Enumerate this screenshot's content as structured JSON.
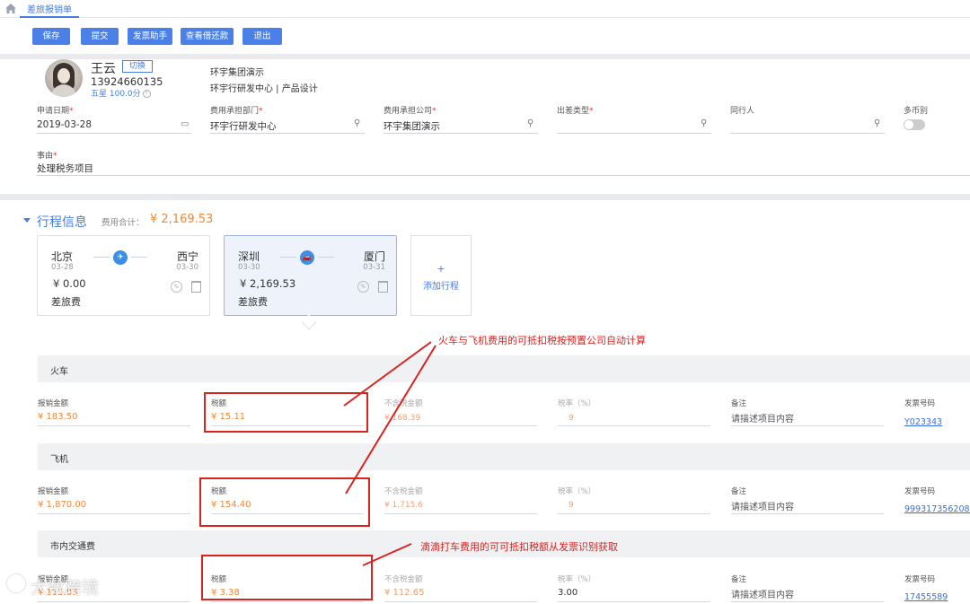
{
  "tab": {
    "title": "差旅报销单"
  },
  "toolbar": {
    "save": "保存",
    "submit": "提交",
    "invoice_helper": "发票助手",
    "view_repay": "查看借还款",
    "exit": "退出"
  },
  "user": {
    "name": "王云",
    "switch": "切换",
    "phone": "13924660135",
    "star": "五星 100.0分",
    "org_line1": "环宇集团演示",
    "org_line2": "环宇行研发中心 | 产品设计"
  },
  "form": {
    "apply_date_label": "申请日期",
    "apply_date": "2019-03-28",
    "dept_label": "费用承担部门",
    "dept": "环宇行研发中心",
    "company_label": "费用承担公司",
    "company": "环宇集团演示",
    "trip_type_label": "出差类型",
    "trip_type": "",
    "companion_label": "同行人",
    "companion": "",
    "multi_currency_label": "多币别",
    "reason_label": "事由",
    "reason": "处理税务项目"
  },
  "itinerary": {
    "title": "行程信息",
    "total_label": "费用合计：",
    "total": "¥ 2,169.53",
    "add_label": "添加行程",
    "add_plus": "+",
    "trips": [
      {
        "from": "北京",
        "to": "西宁",
        "from_date": "03-28",
        "to_date": "03-30",
        "amount": "¥ 0.00",
        "kind": "差旅费",
        "mode_icon": "plane-icon"
      },
      {
        "from": "深圳",
        "to": "厦门",
        "from_date": "03-30",
        "to_date": "03-31",
        "amount": "¥ 2,169.53",
        "kind": "差旅费",
        "mode_icon": "car-icon"
      }
    ]
  },
  "columns": {
    "amount": "报销金额",
    "tax": "税额",
    "no_tax": "不含税金额",
    "rate": "税率（%）",
    "note": "备注",
    "invoice_no": "发票号码"
  },
  "groups": [
    {
      "title": "火车",
      "amount": "¥ 183.50",
      "tax": "¥ 15.11",
      "no_tax": "¥ 168.39",
      "rate": "9",
      "note": "请描述项目内容",
      "invoice": "Y023343"
    },
    {
      "title": "飞机",
      "amount": "¥ 1,870.00",
      "tax": "¥ 154.40",
      "no_tax": "¥ 1,715.6",
      "rate": "9",
      "note": "请描述项目内容",
      "invoice": "9993173562087"
    },
    {
      "title": "市内交通费",
      "amount": "¥ 115.03",
      "tax": "¥ 3.38",
      "no_tax": "¥ 112.65",
      "rate": "3.00",
      "note": "请描述项目内容",
      "invoice": "17455589"
    }
  ],
  "annotations": {
    "top": "火车与飞机费用的可抵扣税按预置公司自动计算",
    "bottom": "滴滴打车费用的可可抵扣税额从发票识别获取"
  },
  "watermark": "大数跨境",
  "colors": {
    "accent": "#4a7de0",
    "button": "#4a80e8",
    "orange": "#f0883a",
    "annotation_red": "#d9231f"
  }
}
